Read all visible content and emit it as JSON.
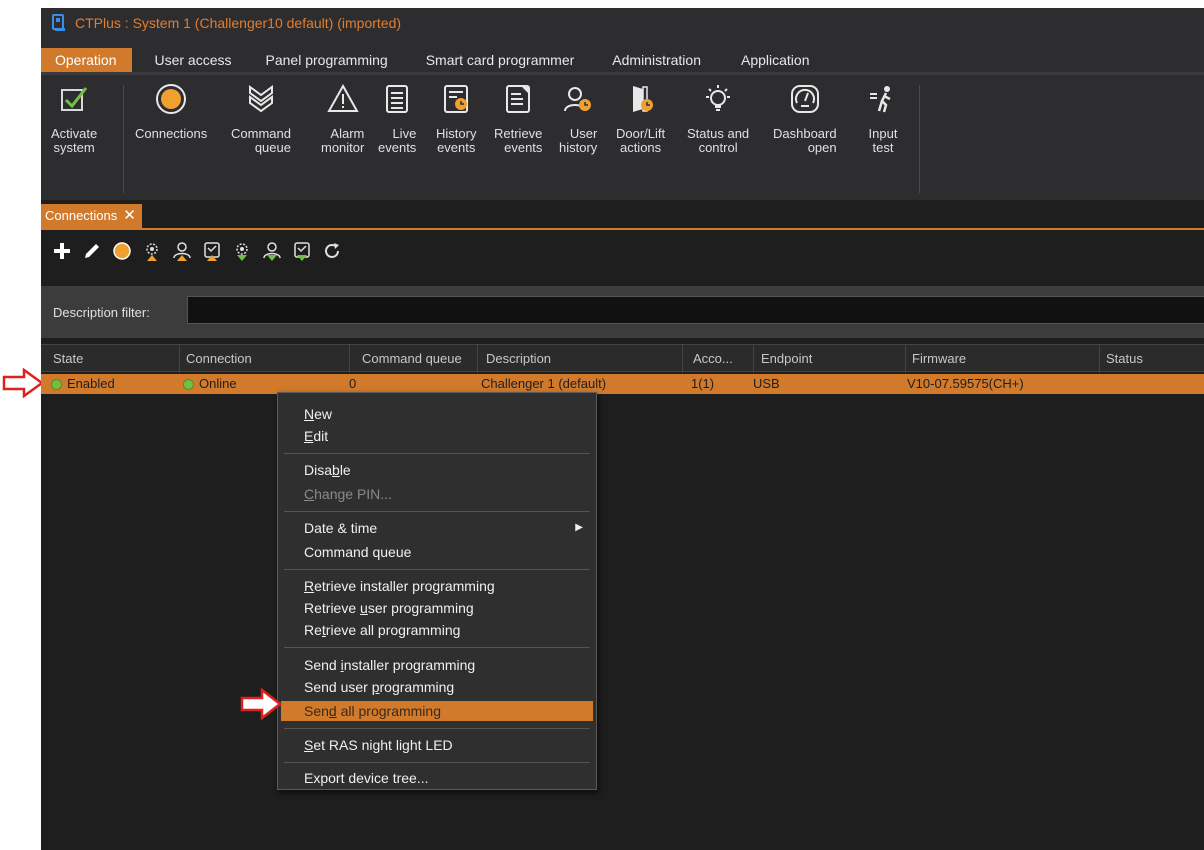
{
  "window": {
    "title": "CTPlus : System 1 (Challenger10 default) (imported)"
  },
  "menu": {
    "tabs": [
      {
        "label": "Operation",
        "active": true
      },
      {
        "label": "User access"
      },
      {
        "label": "Panel programming"
      },
      {
        "label": "Smart card programmer"
      },
      {
        "label": "Administration"
      },
      {
        "label": "Application"
      }
    ]
  },
  "ribbon": {
    "buttons": [
      {
        "label": "Activate\nsystem",
        "icon": "checkbox-icon"
      },
      {
        "label": "Connections",
        "icon": "connections-icon"
      },
      {
        "label": "Command\nqueue",
        "icon": "command-queue-icon"
      },
      {
        "label": "Alarm\nmonitor",
        "icon": "warning-icon"
      },
      {
        "label": "Live\nevents",
        "icon": "list-icon"
      },
      {
        "label": "History\nevents",
        "icon": "history-events-icon"
      },
      {
        "label": "Retrieve\nevents",
        "icon": "retrieve-events-icon"
      },
      {
        "label": "User\nhistory",
        "icon": "user-history-icon"
      },
      {
        "label": "Door/Lift\nactions",
        "icon": "door-actions-icon"
      },
      {
        "label": "Status and\ncontrol",
        "icon": "lightbulb-icon"
      },
      {
        "label": "Dashboard\nopen",
        "icon": "gauge-icon"
      },
      {
        "label": "Input\ntest",
        "icon": "input-test-icon"
      }
    ]
  },
  "doc_tab": {
    "label": "Connections",
    "close": "✕"
  },
  "toolbar": {
    "icons": [
      "plus-icon",
      "pencil-icon",
      "connect-icon",
      "retrieve-installer-icon",
      "retrieve-user-icon",
      "retrieve-all-icon",
      "send-installer-icon",
      "send-user-icon",
      "send-all-icon",
      "refresh-icon"
    ]
  },
  "filter": {
    "label": "Description filter:",
    "value": ""
  },
  "grid": {
    "columns": [
      "State",
      "Connection",
      "Command queue",
      "Description",
      "Acco...",
      "Endpoint",
      "Firmware",
      "Status"
    ],
    "rows": [
      {
        "state": "Enabled",
        "connection": "Online",
        "command_queue": "0",
        "description": "Challenger 1 (default)",
        "account": "1(1)",
        "endpoint": "USB",
        "firmware": "V10-07.59575(CH+)",
        "status": ""
      }
    ]
  },
  "context_menu": {
    "items": {
      "new": {
        "pre": "",
        "u": "N",
        "post": "ew"
      },
      "edit": {
        "pre": "",
        "u": "E",
        "post": "dit"
      },
      "disable": {
        "pre": "Disa",
        "u": "b",
        "post": "le"
      },
      "change_pin": {
        "pre": "",
        "u": "C",
        "post": "hange PIN..."
      },
      "date_time": "Date & time",
      "command_queue": "Command queue",
      "retrieve_installer": {
        "pre": "",
        "u": "R",
        "post": "etrieve installer programming"
      },
      "retrieve_user": {
        "pre": "Retrieve ",
        "u": "u",
        "post": "ser programming"
      },
      "retrieve_all": {
        "pre": "Re",
        "u": "t",
        "post": "rieve all programming"
      },
      "send_installer": {
        "pre": "Send ",
        "u": "i",
        "post": "nstaller programming"
      },
      "send_user": {
        "pre": "Send user ",
        "u": "p",
        "post": "rogramming"
      },
      "send_all": {
        "pre": "Sen",
        "u": "d",
        "post": " all programming"
      },
      "set_ras": {
        "pre": "",
        "u": "S",
        "post": "et RAS night light LED"
      },
      "export_tree": "Export device tree..."
    }
  },
  "colors": {
    "accent": "#d17a2c",
    "background": "#1e1e1e",
    "online": "#72c043",
    "annotation": "#e0201c"
  }
}
